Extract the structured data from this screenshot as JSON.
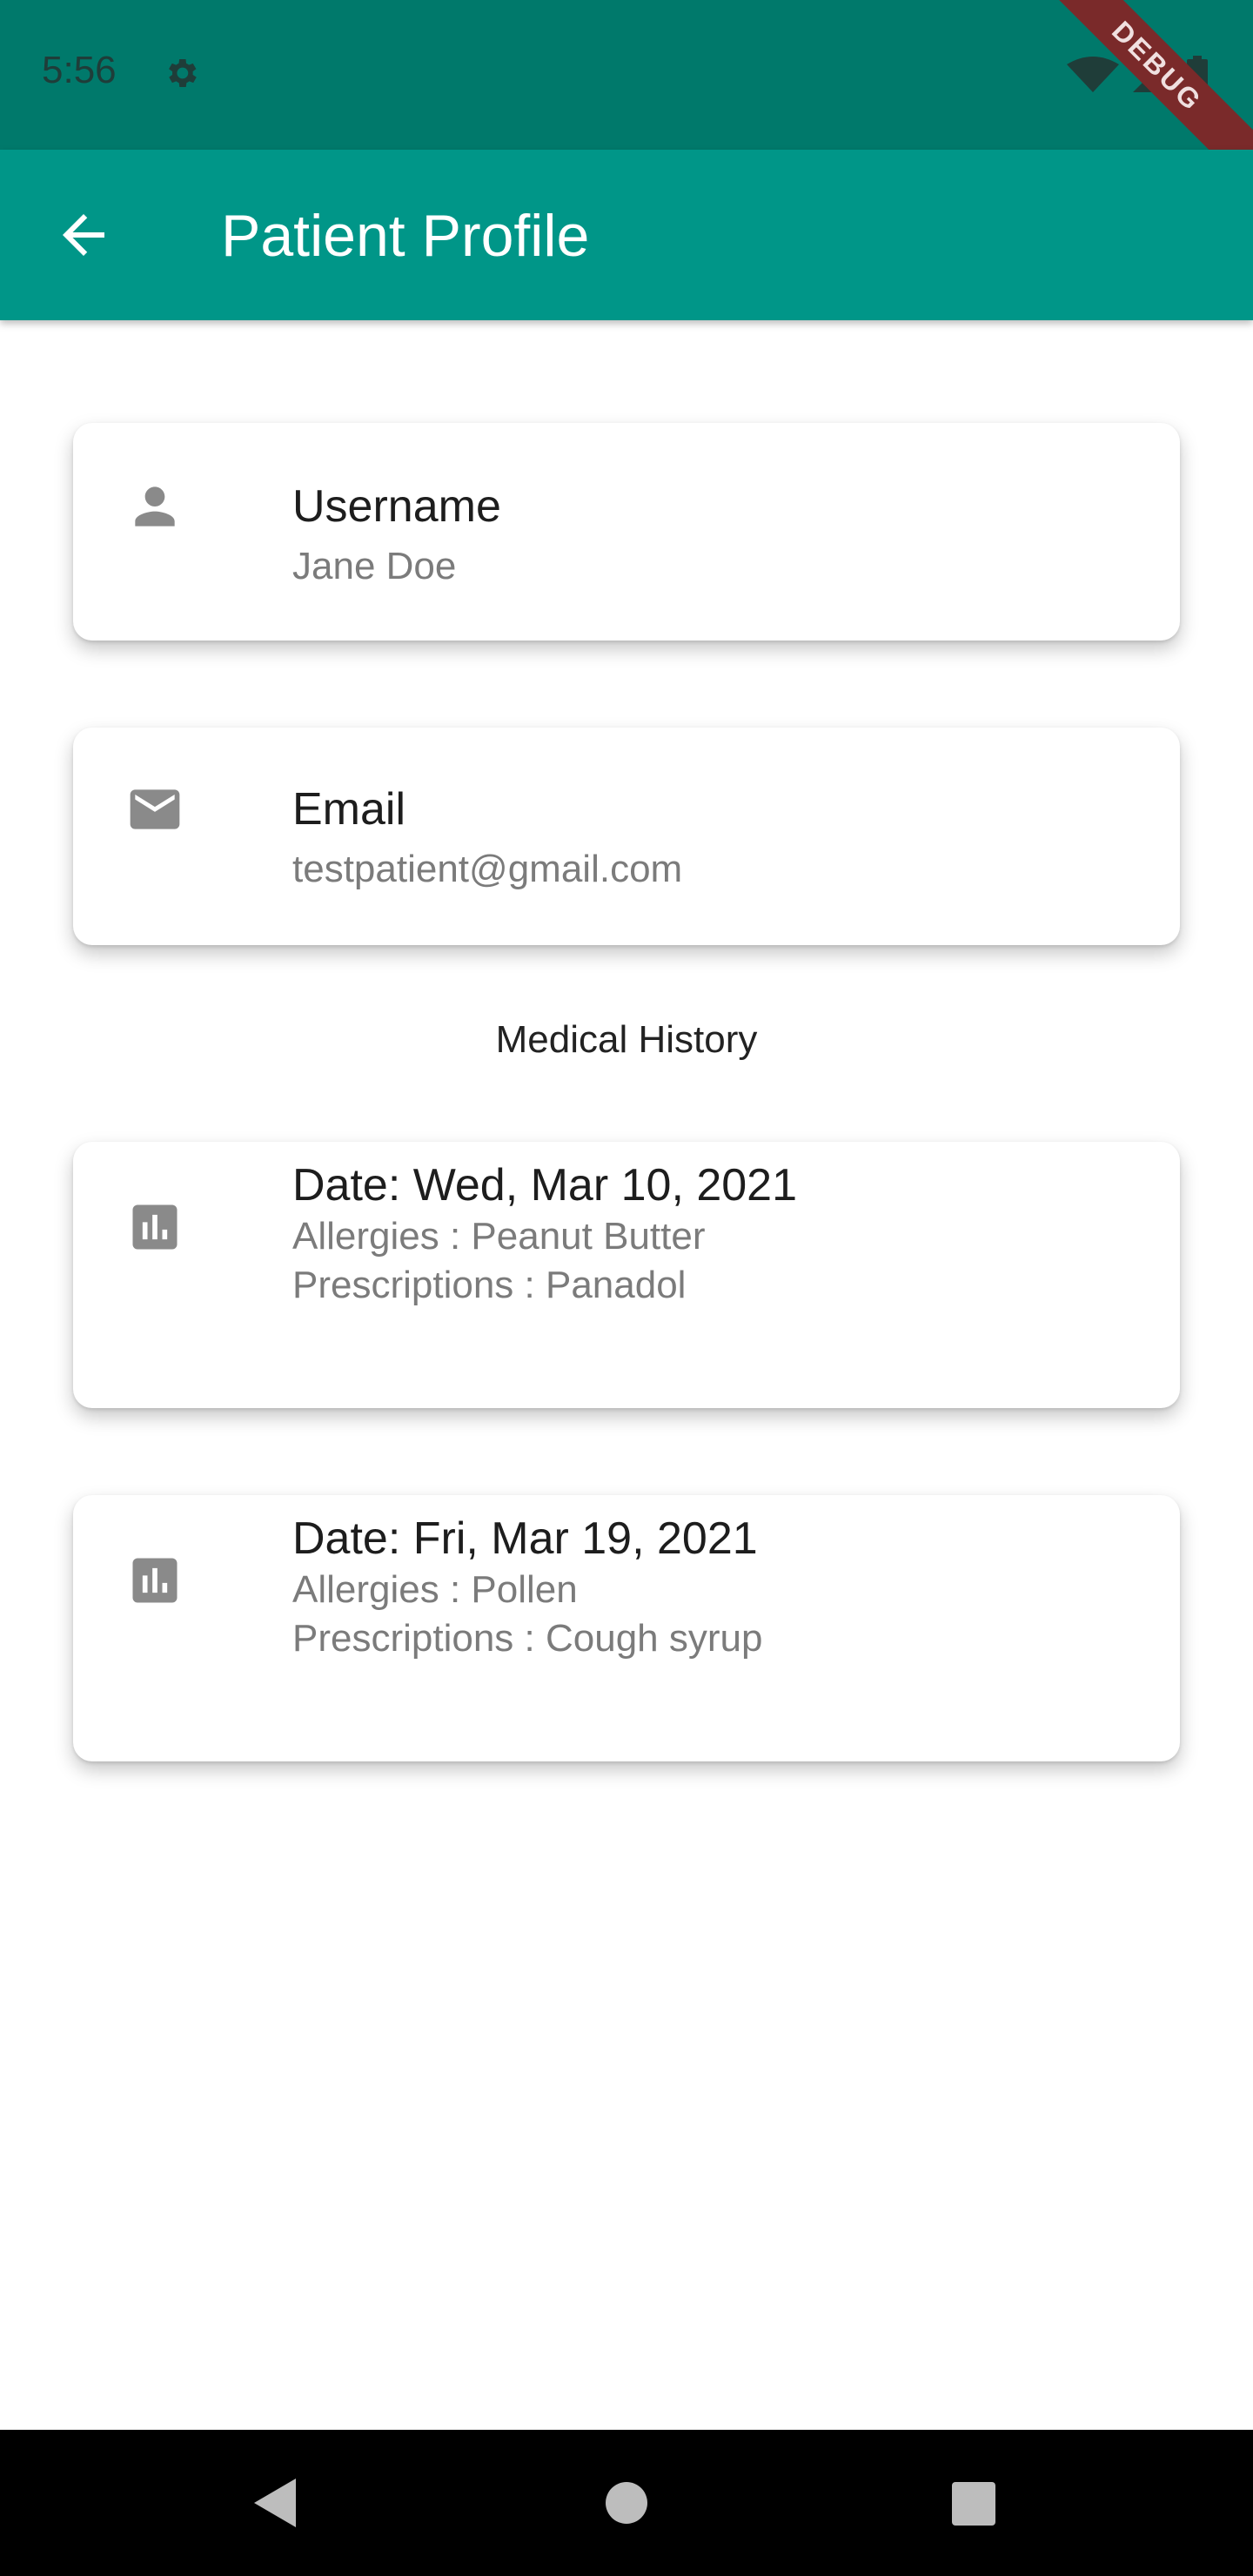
{
  "status_bar": {
    "time": "5:56",
    "icons": [
      "gear-icon",
      "wifi-icon",
      "signal-icon",
      "battery-icon"
    ]
  },
  "debug_banner": "DEBUG",
  "app_bar": {
    "title": "Patient Profile",
    "back_icon": "arrow-back-icon"
  },
  "profile": {
    "username": {
      "label": "Username",
      "value": "Jane Doe",
      "icon": "person-icon"
    },
    "email": {
      "label": "Email",
      "value": "testpatient@gmail.com",
      "icon": "mail-icon"
    }
  },
  "medical_history": {
    "heading": "Medical History",
    "records": [
      {
        "date": "Date: Wed, Mar 10, 2021",
        "allergies": "Allergies : Peanut Butter",
        "prescriptions": "Prescriptions : Panadol",
        "icon": "insert-chart-icon"
      },
      {
        "date": "Date: Fri, Mar 19, 2021",
        "allergies": "Allergies : Pollen",
        "prescriptions": "Prescriptions : Cough syrup",
        "icon": "insert-chart-icon"
      }
    ]
  },
  "nav_bar": {
    "buttons": [
      "back-triangle-icon",
      "home-circle-icon",
      "recents-square-icon"
    ]
  },
  "colors": {
    "status_bar": "#00796b",
    "app_bar": "#009688",
    "icon_gray": "#8a8a8a",
    "debug": "#7a2a2a"
  }
}
